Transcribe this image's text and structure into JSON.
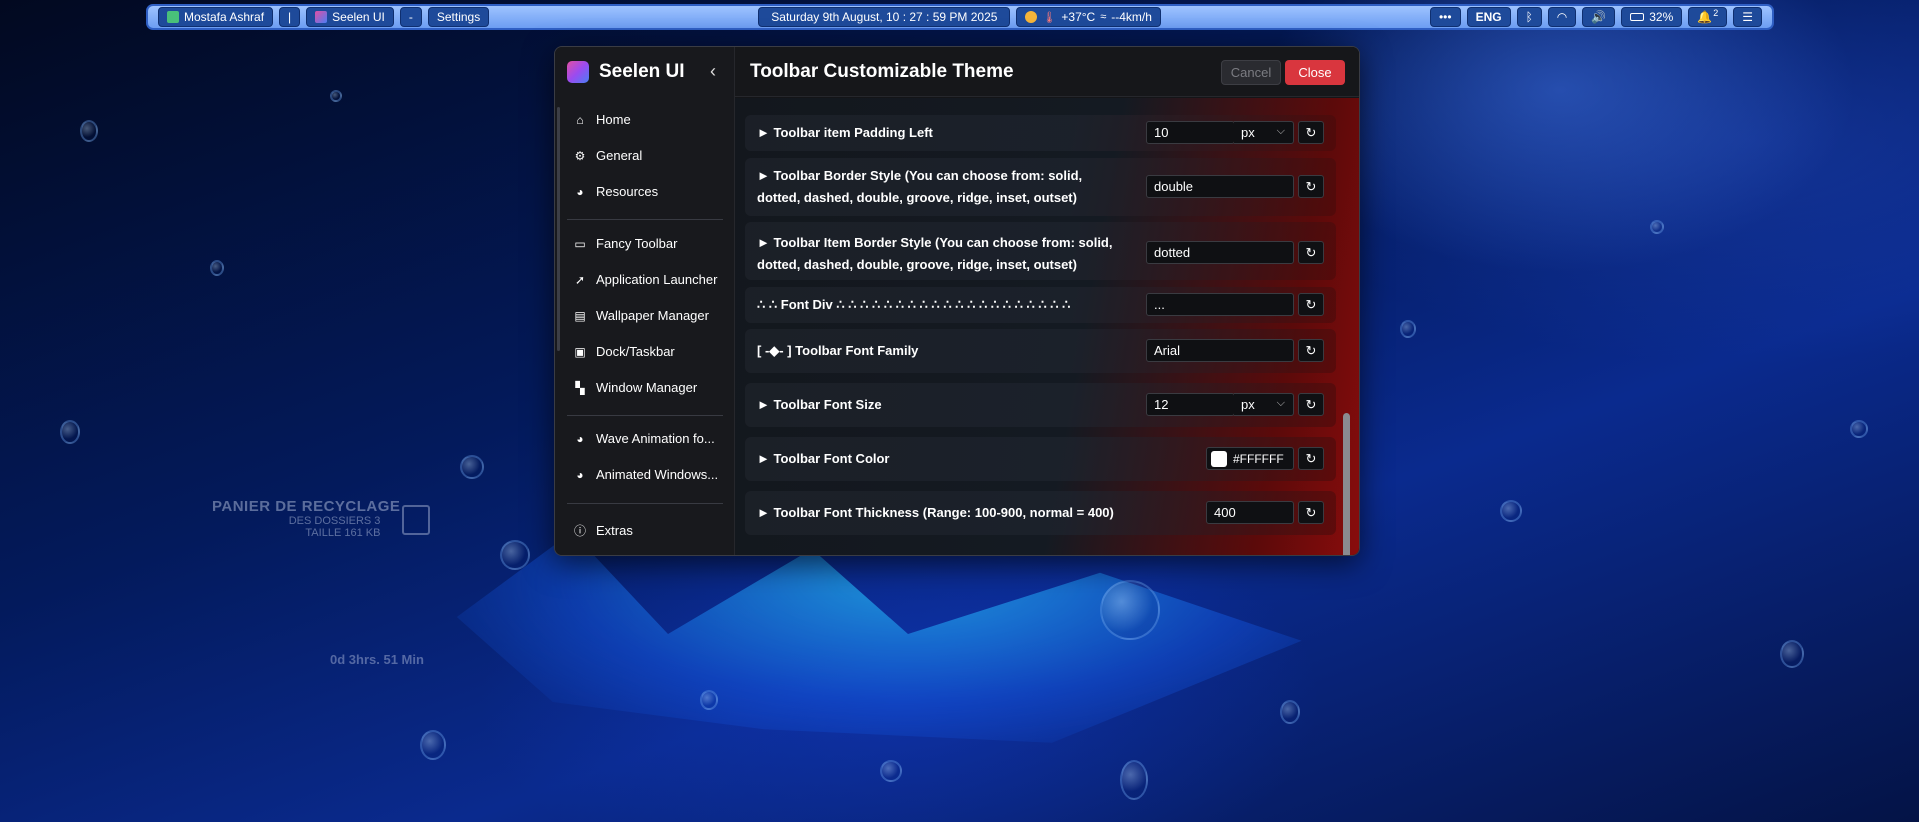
{
  "taskbar": {
    "user": "Mostafa Ashraf",
    "separator": "|",
    "app": "Seelen UI",
    "dash": "-",
    "settings": "Settings",
    "datetime": "Saturday 9th August, 10 : 27 : 59 PM 2025",
    "weather": "+37°C",
    "wind": "--4km/h",
    "more": "•••",
    "lang": "ENG",
    "battery": "32%",
    "notif_count": "2"
  },
  "desktop": {
    "bin_title": "PANIER DE RECYCLAGE",
    "bin_line1": "DES DOSSIERS 3",
    "bin_line2": "TAILLE 161 KB",
    "clock_widget": "0d 3hrs. 51 Min"
  },
  "sidebar": {
    "brand": "Seelen UI",
    "items": [
      {
        "label": "Home",
        "icon": "home-icon"
      },
      {
        "label": "General",
        "icon": "gear-icon"
      },
      {
        "label": "Resources",
        "icon": "palette-icon"
      },
      {
        "label": "Fancy Toolbar",
        "icon": "toolbar-icon"
      },
      {
        "label": "Application Launcher",
        "icon": "rocket-icon"
      },
      {
        "label": "Wallpaper Manager",
        "icon": "wallpaper-icon"
      },
      {
        "label": "Dock/Taskbar",
        "icon": "dock-icon"
      },
      {
        "label": "Window Manager",
        "icon": "window-grid-icon"
      },
      {
        "label": "Wave Animation fo...",
        "icon": "palette-icon"
      },
      {
        "label": "Animated Windows...",
        "icon": "palette-icon"
      },
      {
        "label": "Extras",
        "icon": "info-icon"
      }
    ]
  },
  "header": {
    "title": "Toolbar Customizable Theme",
    "cancel": "Cancel",
    "close": "Close"
  },
  "settings": {
    "padding_left": {
      "label": "► Toolbar item Padding Left",
      "value": "10",
      "unit": "px"
    },
    "border_style": {
      "label_line1": "► Toolbar Border Style (You can choose from: solid,",
      "label_line2": "dotted, dashed, double, groove, ridge, inset, outset)",
      "value": "double"
    },
    "item_border_style": {
      "label_line1": "► Toolbar Item Border Style (You can choose from: solid,",
      "label_line2": "dotted, dashed, double, groove, ridge, inset, outset)",
      "value": "dotted"
    },
    "font_div": {
      "label": "∴ ∴ Font Div ∴ ∴ ∴ ∴ ∴ ∴ ∴ ∴ ∴ ∴ ∴ ∴ ∴ ∴ ∴ ∴ ∴ ∴ ∴ ∴",
      "value": "..."
    },
    "font_family": {
      "label": "[ -◆- ] Toolbar Font Family",
      "value": "Arial"
    },
    "font_size": {
      "label": "► Toolbar Font Size",
      "value": "12",
      "unit": "px"
    },
    "font_color": {
      "label": "► Toolbar Font Color",
      "value": "#FFFFFF"
    },
    "font_thickness": {
      "label": "► Toolbar Font Thickness (Range: 100-900, normal = 400)",
      "value": "400"
    }
  }
}
